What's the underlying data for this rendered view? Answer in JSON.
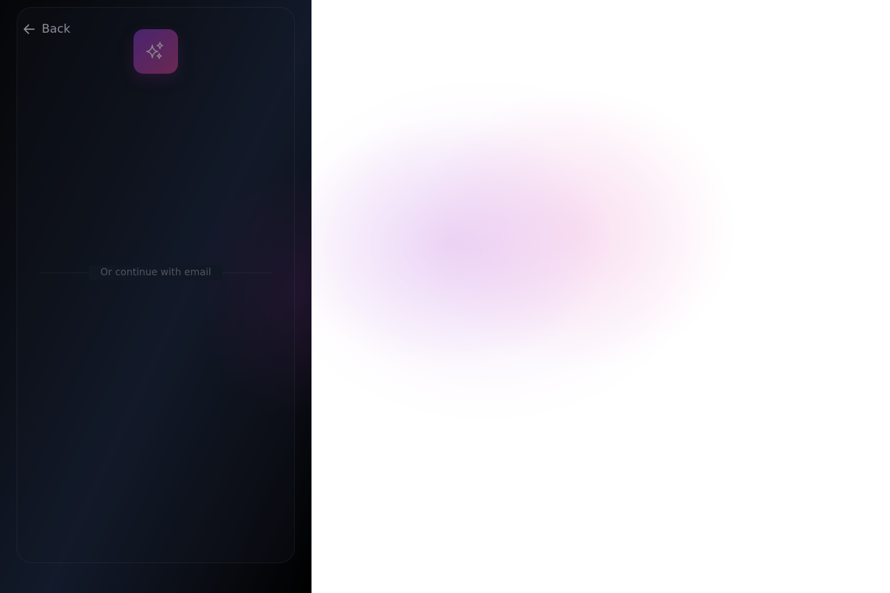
{
  "nav": {
    "back_label": "Back",
    "back_icon": "arrow-left-icon"
  },
  "logo": {
    "icon": "sparkles-icon",
    "gradient": [
      "#4a2470",
      "#6a2850"
    ]
  },
  "auth": {
    "divider_text": "Or continue with email"
  }
}
